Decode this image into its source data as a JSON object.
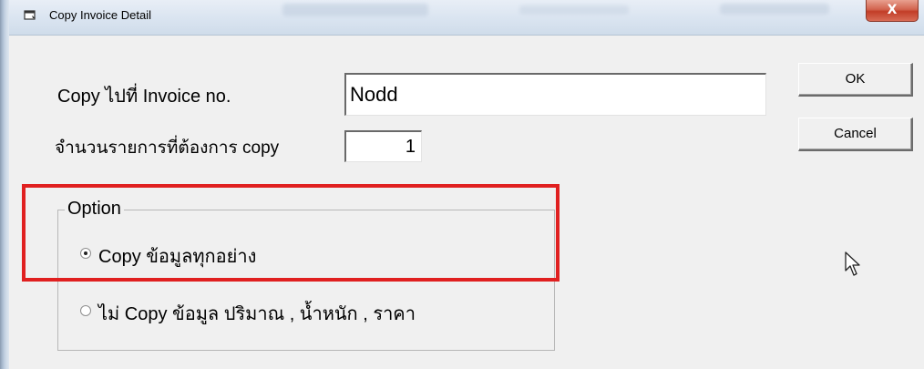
{
  "window": {
    "title": "Copy Invoice Detail",
    "close_label": "X"
  },
  "form": {
    "invoice_label": "Copy ไปที่ Invoice no.",
    "invoice_value": "Nodd",
    "count_label": "จำนวนรายการที่ต้องการ copy",
    "count_value": "1"
  },
  "buttons": {
    "ok": "OK",
    "cancel": "Cancel"
  },
  "options": {
    "group_title": "Option",
    "items": [
      {
        "label": "Copy ข้อมูลทุกอย่าง",
        "checked": true
      },
      {
        "label": "ไม่ Copy ข้อมูล ปริมาณ , น้ำหนัก , ราคา",
        "checked": false
      }
    ]
  },
  "colors": {
    "highlight": "#e02020",
    "dialog_bg": "#f0f0f0"
  },
  "icons": {
    "app": "window-icon",
    "cursor": "mouse-pointer-icon"
  }
}
